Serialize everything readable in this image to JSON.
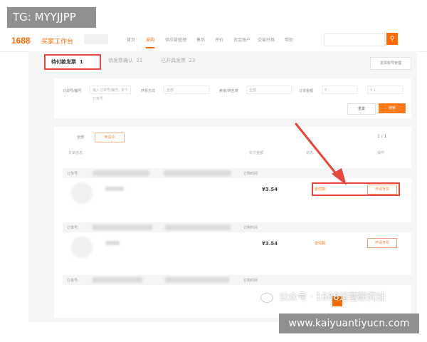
{
  "overlay": {
    "tg_label": "TG: MYYJJPP",
    "watermark": "公众号 · 1688运营研究社",
    "url": "www.kaiyuantiyucn.com"
  },
  "header": {
    "logo": "1688",
    "logo_sub": "买家工作台",
    "nav": [
      "首页",
      "采购",
      "供应链管理",
      "售后",
      "评价",
      "资金账户",
      "交易开具",
      "帮助"
    ],
    "active_nav": "采购",
    "search_icon": "search-icon"
  },
  "tabs": {
    "active": "待付款发票",
    "active_count": "1",
    "second": "待发票确认",
    "second_count": "21",
    "third": "已开具发票",
    "third_count": "23",
    "right_button": "发票税号管理"
  },
  "filters": {
    "order_label": "订单号/编号",
    "order_placeholder": "输入订单号/编号, 多个订单号",
    "method_label": "开票方式",
    "method_value": "全部",
    "seller_label": "卖家/供应商",
    "seller_value": "全部",
    "amount_label": "订单金额",
    "amount_from": "¥",
    "amount_to": "¥ 1",
    "amount_to_placeholder": "最高价",
    "reset": "重置",
    "query": "搜索"
  },
  "list": {
    "subtab_all": "全部",
    "subtab_active": "申请中",
    "pager": "1 / 1",
    "columns": [
      "订单信息",
      "实付金额",
      "状态",
      "操作"
    ],
    "orders": [
      {
        "header_label": "订单号:",
        "date_label": "订购时间",
        "price": "¥3.54",
        "status_link": "去付款",
        "action": "申请开票"
      },
      {
        "header_label": "订单号:",
        "date_label": "订购时间",
        "price": "¥3.54",
        "status_link": "去付款",
        "action": "申请开票"
      },
      {
        "header_label": "订单号:",
        "date_label": "订购时间",
        "price": "",
        "status_link": "",
        "action": ""
      }
    ]
  },
  "colors": {
    "accent": "#ff6a00",
    "highlight": "#e8453c"
  }
}
